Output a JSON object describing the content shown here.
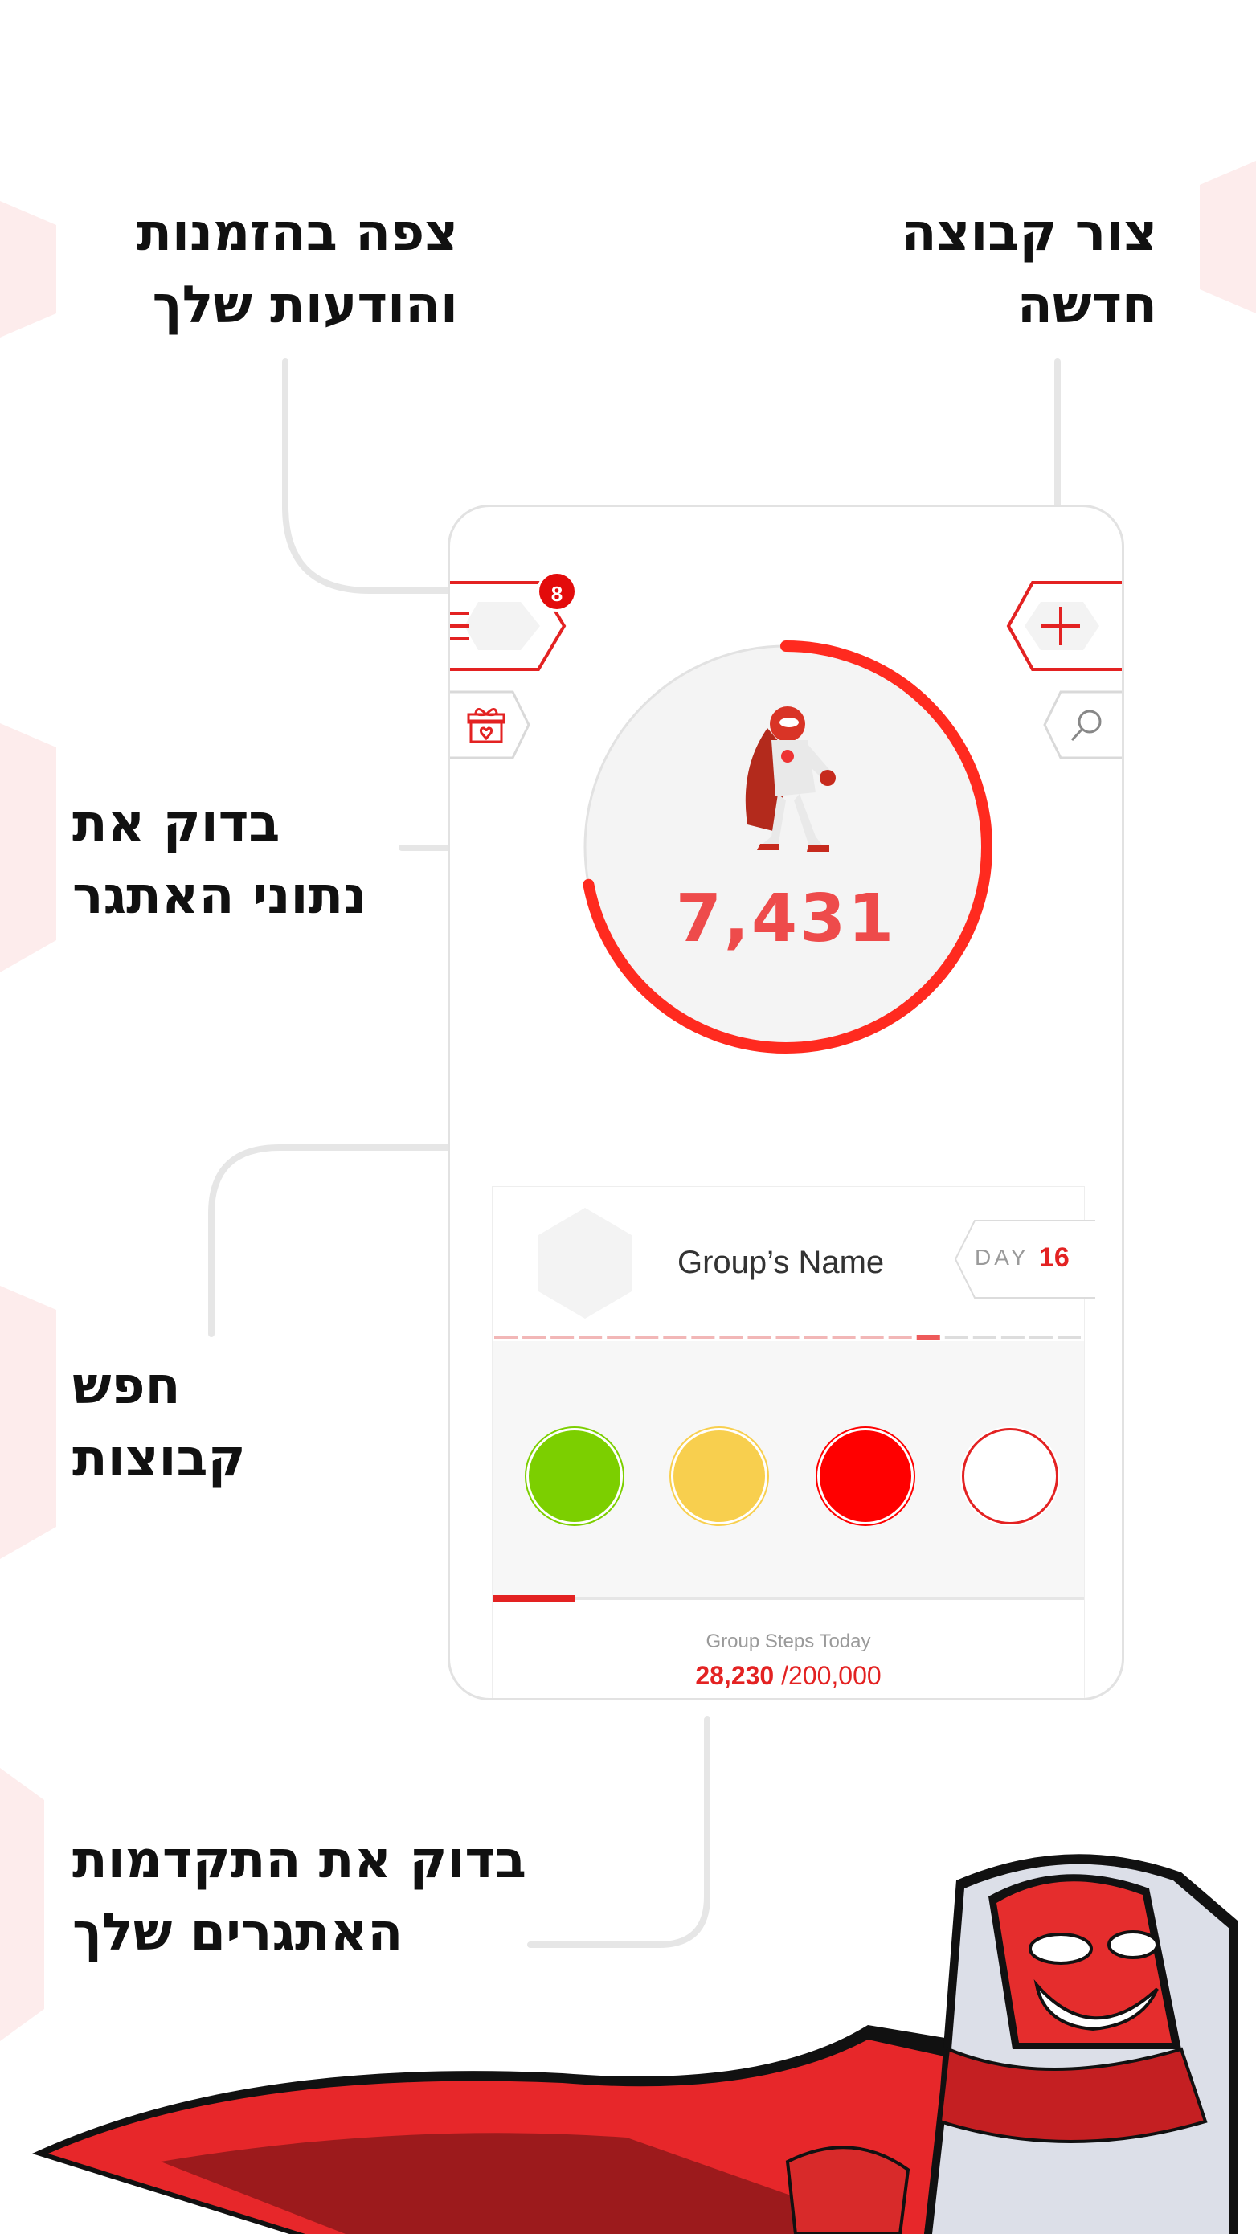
{
  "callouts": {
    "create_group": [
      "צור קבוצה",
      "חדשה"
    ],
    "invitations": [
      "צפה בהזמנות",
      "והודעות שלך"
    ],
    "challenge_data": [
      "בדוק את",
      "נתוני האתגר"
    ],
    "search_groups": [
      "חפש",
      "קבוצות"
    ],
    "progress": [
      "בדוק את התקדמות",
      "האתגרים שלך"
    ]
  },
  "app": {
    "notification_count": "8",
    "step_count": "7,431",
    "step_ring_progress": 0.72,
    "group": {
      "name": "Group’s Name",
      "day_label": "DAY",
      "day_value": "16",
      "timeline_total_segments": 21,
      "timeline_current_segment": 15,
      "member_status_colors": [
        "#7ccf00",
        "#f8cf4e",
        "#ff0000",
        "#ffffff"
      ],
      "steps_label": "Group Steps Today",
      "steps_value": "28,230",
      "steps_goal": "/200,000",
      "steps_progress": 0.14
    }
  },
  "icons": {
    "menu": "menu-icon",
    "add": "plus-icon",
    "gift": "gift-icon",
    "search": "search-icon",
    "mascot": "superhero-mascot"
  },
  "colors": {
    "accent": "#e32222",
    "count_text": "#ee4b4b",
    "ring": "#ff2a1f",
    "line": "#e6e6e6"
  }
}
